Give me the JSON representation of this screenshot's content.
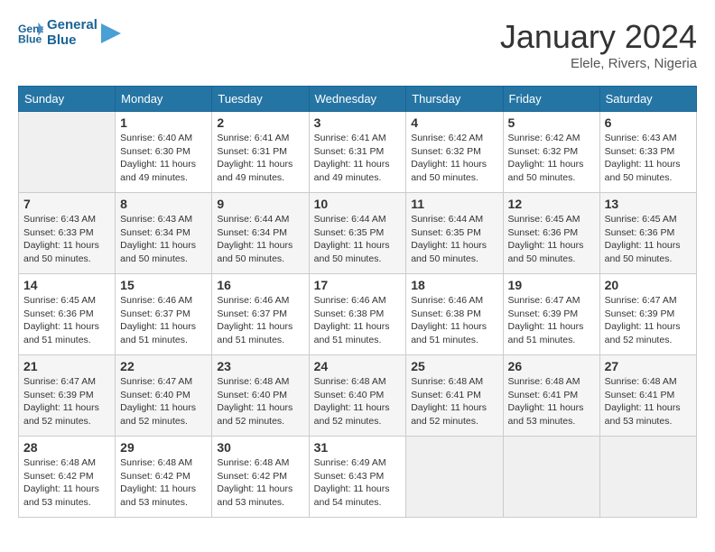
{
  "logo": {
    "line1": "General",
    "line2": "Blue"
  },
  "title": "January 2024",
  "location": "Elele, Rivers, Nigeria",
  "weekdays": [
    "Sunday",
    "Monday",
    "Tuesday",
    "Wednesday",
    "Thursday",
    "Friday",
    "Saturday"
  ],
  "weeks": [
    [
      {
        "day": "",
        "info": ""
      },
      {
        "day": "1",
        "info": "Sunrise: 6:40 AM\nSunset: 6:30 PM\nDaylight: 11 hours\nand 49 minutes."
      },
      {
        "day": "2",
        "info": "Sunrise: 6:41 AM\nSunset: 6:31 PM\nDaylight: 11 hours\nand 49 minutes."
      },
      {
        "day": "3",
        "info": "Sunrise: 6:41 AM\nSunset: 6:31 PM\nDaylight: 11 hours\nand 49 minutes."
      },
      {
        "day": "4",
        "info": "Sunrise: 6:42 AM\nSunset: 6:32 PM\nDaylight: 11 hours\nand 50 minutes."
      },
      {
        "day": "5",
        "info": "Sunrise: 6:42 AM\nSunset: 6:32 PM\nDaylight: 11 hours\nand 50 minutes."
      },
      {
        "day": "6",
        "info": "Sunrise: 6:43 AM\nSunset: 6:33 PM\nDaylight: 11 hours\nand 50 minutes."
      }
    ],
    [
      {
        "day": "7",
        "info": "Sunrise: 6:43 AM\nSunset: 6:33 PM\nDaylight: 11 hours\nand 50 minutes."
      },
      {
        "day": "8",
        "info": "Sunrise: 6:43 AM\nSunset: 6:34 PM\nDaylight: 11 hours\nand 50 minutes."
      },
      {
        "day": "9",
        "info": "Sunrise: 6:44 AM\nSunset: 6:34 PM\nDaylight: 11 hours\nand 50 minutes."
      },
      {
        "day": "10",
        "info": "Sunrise: 6:44 AM\nSunset: 6:35 PM\nDaylight: 11 hours\nand 50 minutes."
      },
      {
        "day": "11",
        "info": "Sunrise: 6:44 AM\nSunset: 6:35 PM\nDaylight: 11 hours\nand 50 minutes."
      },
      {
        "day": "12",
        "info": "Sunrise: 6:45 AM\nSunset: 6:36 PM\nDaylight: 11 hours\nand 50 minutes."
      },
      {
        "day": "13",
        "info": "Sunrise: 6:45 AM\nSunset: 6:36 PM\nDaylight: 11 hours\nand 50 minutes."
      }
    ],
    [
      {
        "day": "14",
        "info": "Sunrise: 6:45 AM\nSunset: 6:36 PM\nDaylight: 11 hours\nand 51 minutes."
      },
      {
        "day": "15",
        "info": "Sunrise: 6:46 AM\nSunset: 6:37 PM\nDaylight: 11 hours\nand 51 minutes."
      },
      {
        "day": "16",
        "info": "Sunrise: 6:46 AM\nSunset: 6:37 PM\nDaylight: 11 hours\nand 51 minutes."
      },
      {
        "day": "17",
        "info": "Sunrise: 6:46 AM\nSunset: 6:38 PM\nDaylight: 11 hours\nand 51 minutes."
      },
      {
        "day": "18",
        "info": "Sunrise: 6:46 AM\nSunset: 6:38 PM\nDaylight: 11 hours\nand 51 minutes."
      },
      {
        "day": "19",
        "info": "Sunrise: 6:47 AM\nSunset: 6:39 PM\nDaylight: 11 hours\nand 51 minutes."
      },
      {
        "day": "20",
        "info": "Sunrise: 6:47 AM\nSunset: 6:39 PM\nDaylight: 11 hours\nand 52 minutes."
      }
    ],
    [
      {
        "day": "21",
        "info": "Sunrise: 6:47 AM\nSunset: 6:39 PM\nDaylight: 11 hours\nand 52 minutes."
      },
      {
        "day": "22",
        "info": "Sunrise: 6:47 AM\nSunset: 6:40 PM\nDaylight: 11 hours\nand 52 minutes."
      },
      {
        "day": "23",
        "info": "Sunrise: 6:48 AM\nSunset: 6:40 PM\nDaylight: 11 hours\nand 52 minutes."
      },
      {
        "day": "24",
        "info": "Sunrise: 6:48 AM\nSunset: 6:40 PM\nDaylight: 11 hours\nand 52 minutes."
      },
      {
        "day": "25",
        "info": "Sunrise: 6:48 AM\nSunset: 6:41 PM\nDaylight: 11 hours\nand 52 minutes."
      },
      {
        "day": "26",
        "info": "Sunrise: 6:48 AM\nSunset: 6:41 PM\nDaylight: 11 hours\nand 53 minutes."
      },
      {
        "day": "27",
        "info": "Sunrise: 6:48 AM\nSunset: 6:41 PM\nDaylight: 11 hours\nand 53 minutes."
      }
    ],
    [
      {
        "day": "28",
        "info": "Sunrise: 6:48 AM\nSunset: 6:42 PM\nDaylight: 11 hours\nand 53 minutes."
      },
      {
        "day": "29",
        "info": "Sunrise: 6:48 AM\nSunset: 6:42 PM\nDaylight: 11 hours\nand 53 minutes."
      },
      {
        "day": "30",
        "info": "Sunrise: 6:48 AM\nSunset: 6:42 PM\nDaylight: 11 hours\nand 53 minutes."
      },
      {
        "day": "31",
        "info": "Sunrise: 6:49 AM\nSunset: 6:43 PM\nDaylight: 11 hours\nand 54 minutes."
      },
      {
        "day": "",
        "info": ""
      },
      {
        "day": "",
        "info": ""
      },
      {
        "day": "",
        "info": ""
      }
    ]
  ]
}
